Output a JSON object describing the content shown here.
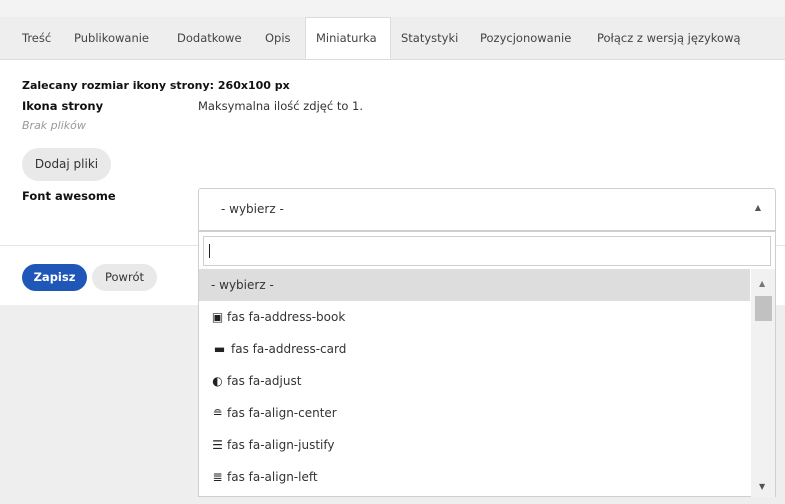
{
  "tabs": [
    "Treść",
    "Publikowanie",
    "Dodatkowe",
    "Opis",
    "Miniaturka",
    "Statystyki",
    "Pozycjonowanie",
    "Połącz z wersją językową"
  ],
  "active_tab": "Miniaturka",
  "form": {
    "recommended_size": "Zalecany rozmiar ikony strony: 260x100 px",
    "icon_label": "Ikona strony",
    "max_photos": "Maksymalna ilość zdjęć to 1.",
    "no_files": "Brak plików",
    "add_files_button": "Dodaj pliki",
    "font_awesome_label": "Font awesome"
  },
  "select": {
    "selected_value": "- wybierz -",
    "search_value": "",
    "options": [
      {
        "icon": "",
        "label": "- wybierz -"
      },
      {
        "icon": "address-book-icon",
        "label": "fas fa-address-book"
      },
      {
        "icon": "address-card-icon",
        "label": "fas fa-address-card"
      },
      {
        "icon": "adjust-icon",
        "label": "fas fa-adjust"
      },
      {
        "icon": "align-center-icon",
        "label": "fas fa-align-center"
      },
      {
        "icon": "align-justify-icon",
        "label": "fas fa-align-justify"
      },
      {
        "icon": "align-left-icon",
        "label": "fas fa-align-left"
      }
    ]
  },
  "actions": {
    "save_button": "Zapisz",
    "back_button": "Powrót"
  },
  "colors": {
    "primary": "#1f57b8",
    "highlight": "#dddddd"
  }
}
